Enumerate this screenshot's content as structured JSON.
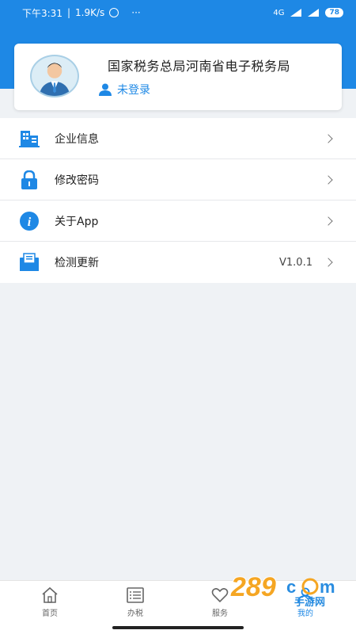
{
  "status": {
    "time": "下午3:31",
    "speed": "1.9K/s",
    "dots": "···",
    "net": "4G",
    "battery": "78"
  },
  "profile": {
    "org_name": "国家税务总局河南省电子税务局",
    "login_label": "未登录"
  },
  "menu": [
    {
      "label": "企业信息",
      "icon": "building-icon"
    },
    {
      "label": "修改密码",
      "icon": "lock-icon"
    },
    {
      "label": "关于App",
      "icon": "info-icon"
    },
    {
      "label": "检测更新",
      "icon": "envelope-icon",
      "value": "V1.0.1"
    }
  ],
  "tabs": [
    {
      "label": "首页",
      "icon": "home-icon"
    },
    {
      "label": "办税",
      "icon": "list-icon"
    },
    {
      "label": "服务",
      "icon": "heart-icon"
    },
    {
      "label": "我的",
      "icon": "user-icon",
      "active": true
    }
  ],
  "watermark": {
    "text": "289",
    "sub": "手游网"
  },
  "colors": {
    "accent": "#1e88e5",
    "background": "#eff2f5"
  }
}
